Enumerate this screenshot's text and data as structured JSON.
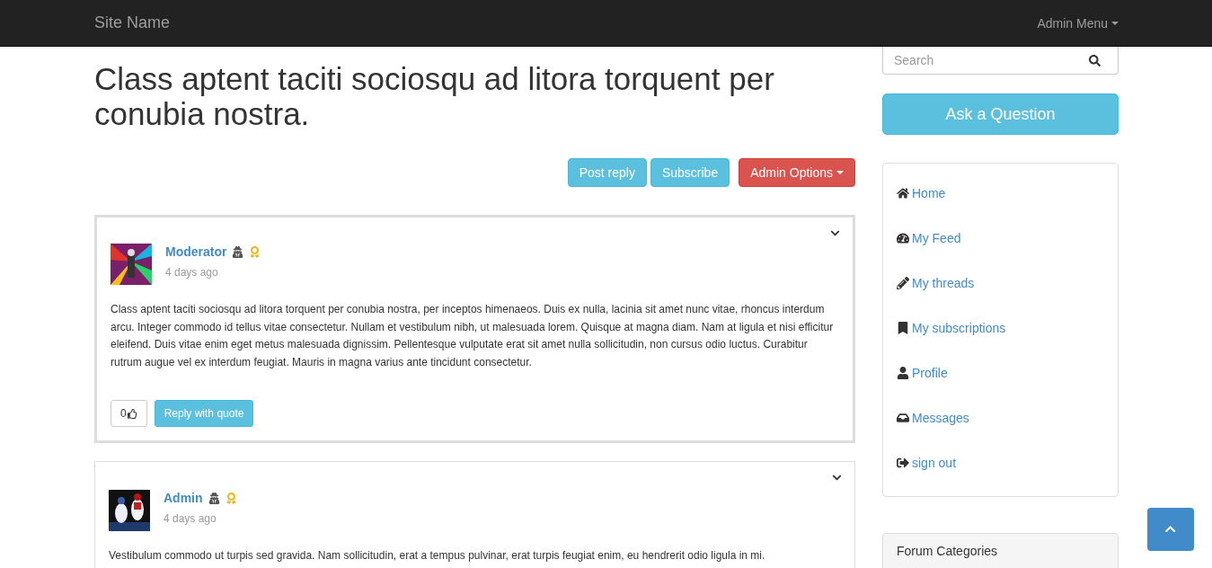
{
  "navbar": {
    "brand": "Site Name",
    "menu": "Admin Menu"
  },
  "thread": {
    "title": "Class aptent taciti sociosqu ad litora torquent per conubia nostra.",
    "actions": [
      {
        "label": "Post reply",
        "kind": "info"
      },
      {
        "label": "Subscribe",
        "kind": "info"
      },
      {
        "label": "Admin Options",
        "kind": "danger"
      }
    ]
  },
  "posts": [
    {
      "author": "Moderator",
      "time": "4 days ago",
      "highlighted": true,
      "body": "Class aptent taciti sociosqu ad litora torquent per conubia nostra, per inceptos himenaeos. Duis ex nulla, lacinia sit amet nunc vitae, rhoncus interdum arcu. Integer commodo id tellus vitae consectetur. Nullam et vestibulum nibh, ut malesuada lorem. Quisque at magna diam. Nam at ligula et nisi efficitur eleifend. Duis vitae enim eget metus malesuada dignissim. Pellentesque vulputate erat sit amet nulla sollicitudin, non cursus odio luctus. Curabitur rutrum augue vel ex interdum feugiat. Mauris in magna varius ante tincidunt consectetur.",
      "likes": "0",
      "reply": "Reply with quote"
    },
    {
      "author": "Admin",
      "time": "4 days ago",
      "highlighted": false,
      "body": "Vestibulum commodo ut turpis sed gravida. Nam sollicitudin, erat a tempus pulvinar, erat turpis feugiat enim, eu hendrerit odio ligula in mi."
    }
  ],
  "sidebar": {
    "search": {
      "placeholder": "Search"
    },
    "ask": "Ask a Question",
    "nav": [
      {
        "label": "Home"
      },
      {
        "label": "My Feed"
      },
      {
        "label": "My threads"
      },
      {
        "label": "My subscriptions"
      },
      {
        "label": "Profile"
      },
      {
        "label": "Messages"
      },
      {
        "label": "sign out"
      }
    ],
    "categories_title": "Forum Categories"
  }
}
